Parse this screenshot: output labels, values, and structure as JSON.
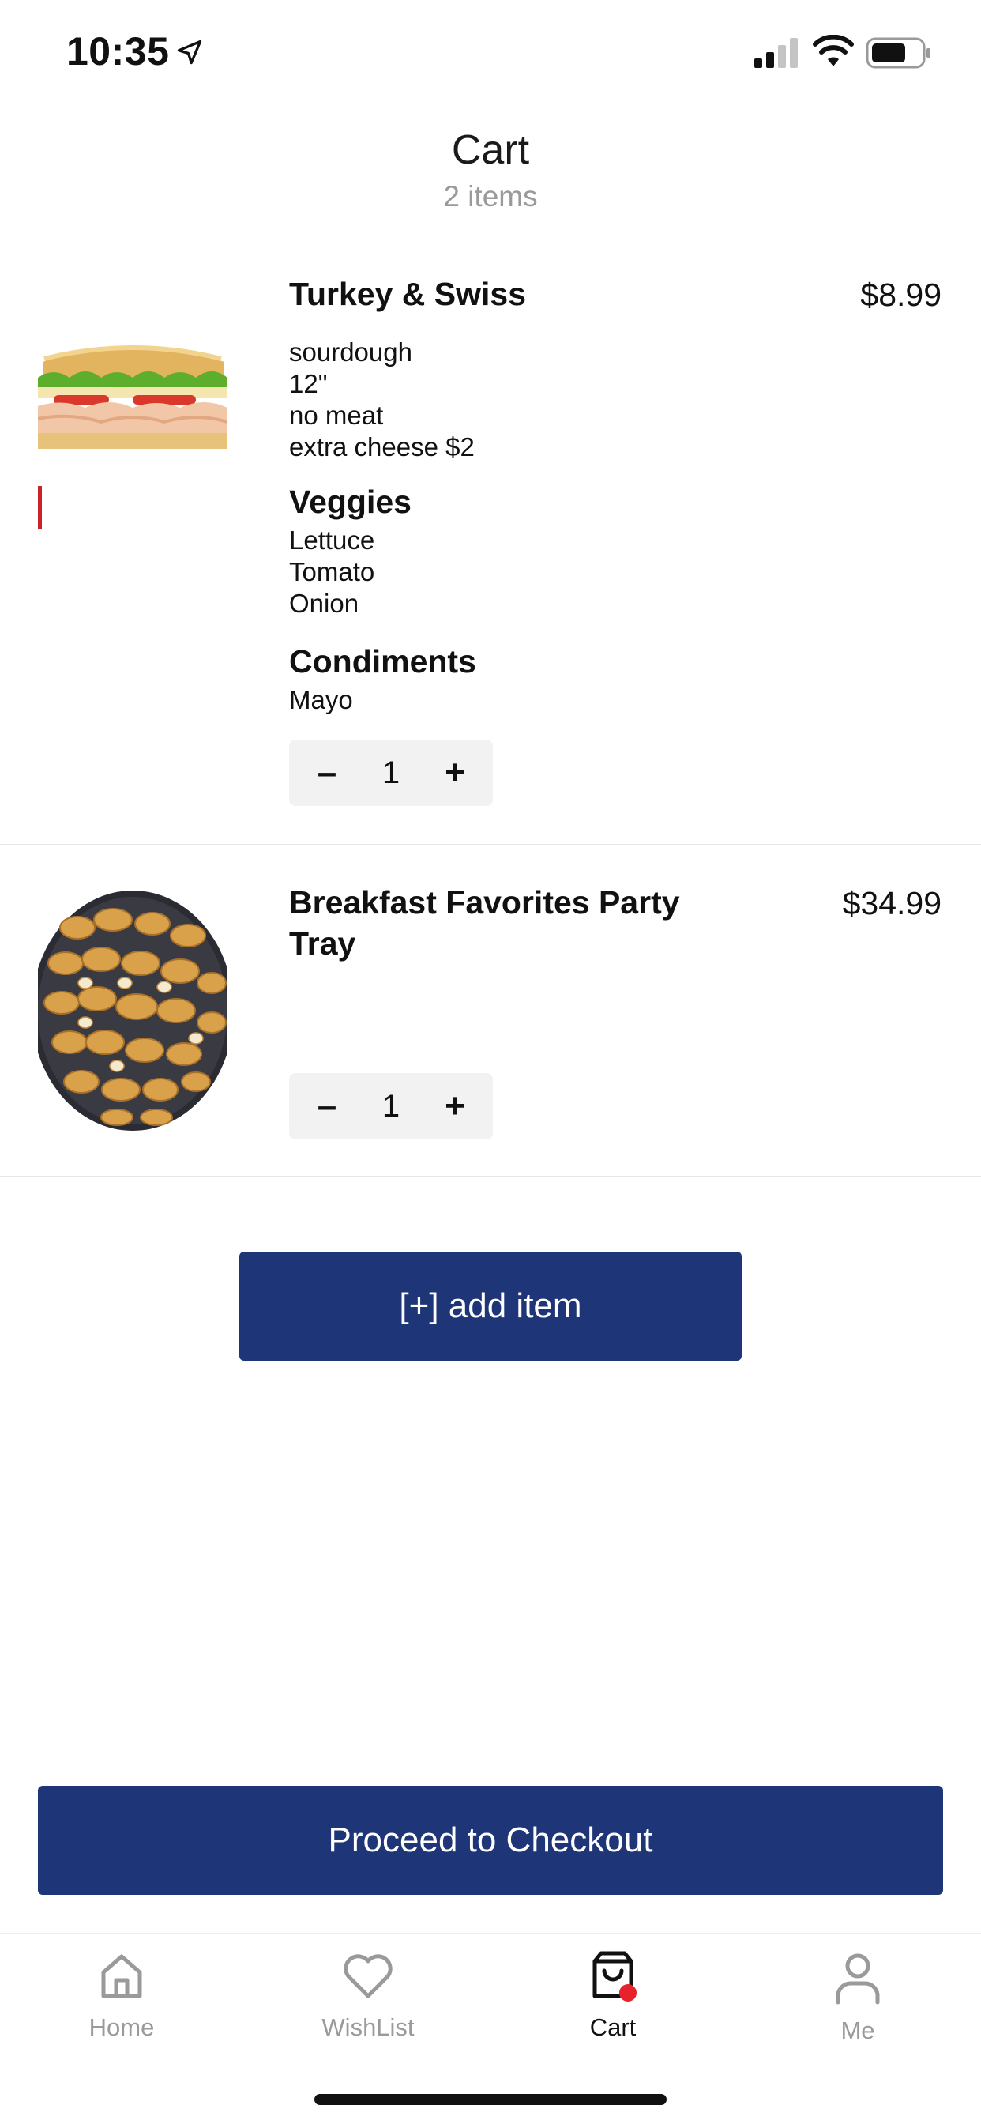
{
  "status_bar": {
    "time": "10:35"
  },
  "header": {
    "title": "Cart",
    "subtitle": "2 items"
  },
  "cart": {
    "items": [
      {
        "name": "Turkey & Swiss",
        "price": "$8.99",
        "options": [
          "sourdough",
          "12\"",
          "no meat",
          "extra cheese $2"
        ],
        "groups": [
          {
            "title": "Veggies",
            "items": [
              "Lettuce",
              "Tomato",
              "Onion"
            ]
          },
          {
            "title": "Condiments",
            "items": [
              "Mayo"
            ]
          }
        ],
        "quantity": {
          "minus": "–",
          "value": "1",
          "plus": "+"
        }
      },
      {
        "name": "Breakfast Favorites Party Tray",
        "price": "$34.99",
        "quantity": {
          "minus": "–",
          "value": "1",
          "plus": "+"
        }
      }
    ]
  },
  "actions": {
    "add_item": "[+] add item",
    "checkout": "Proceed to Checkout"
  },
  "tab_bar": {
    "tabs": [
      {
        "label": "Home",
        "icon": "home-icon"
      },
      {
        "label": "WishList",
        "icon": "heart-icon"
      },
      {
        "label": "Cart",
        "icon": "shopping-bag-icon",
        "active": true,
        "badge": true
      },
      {
        "label": "Me",
        "icon": "person-icon"
      }
    ]
  },
  "colors": {
    "primary": "#1e3677",
    "badge": "#e8222d",
    "muted": "#9a9a9a"
  }
}
